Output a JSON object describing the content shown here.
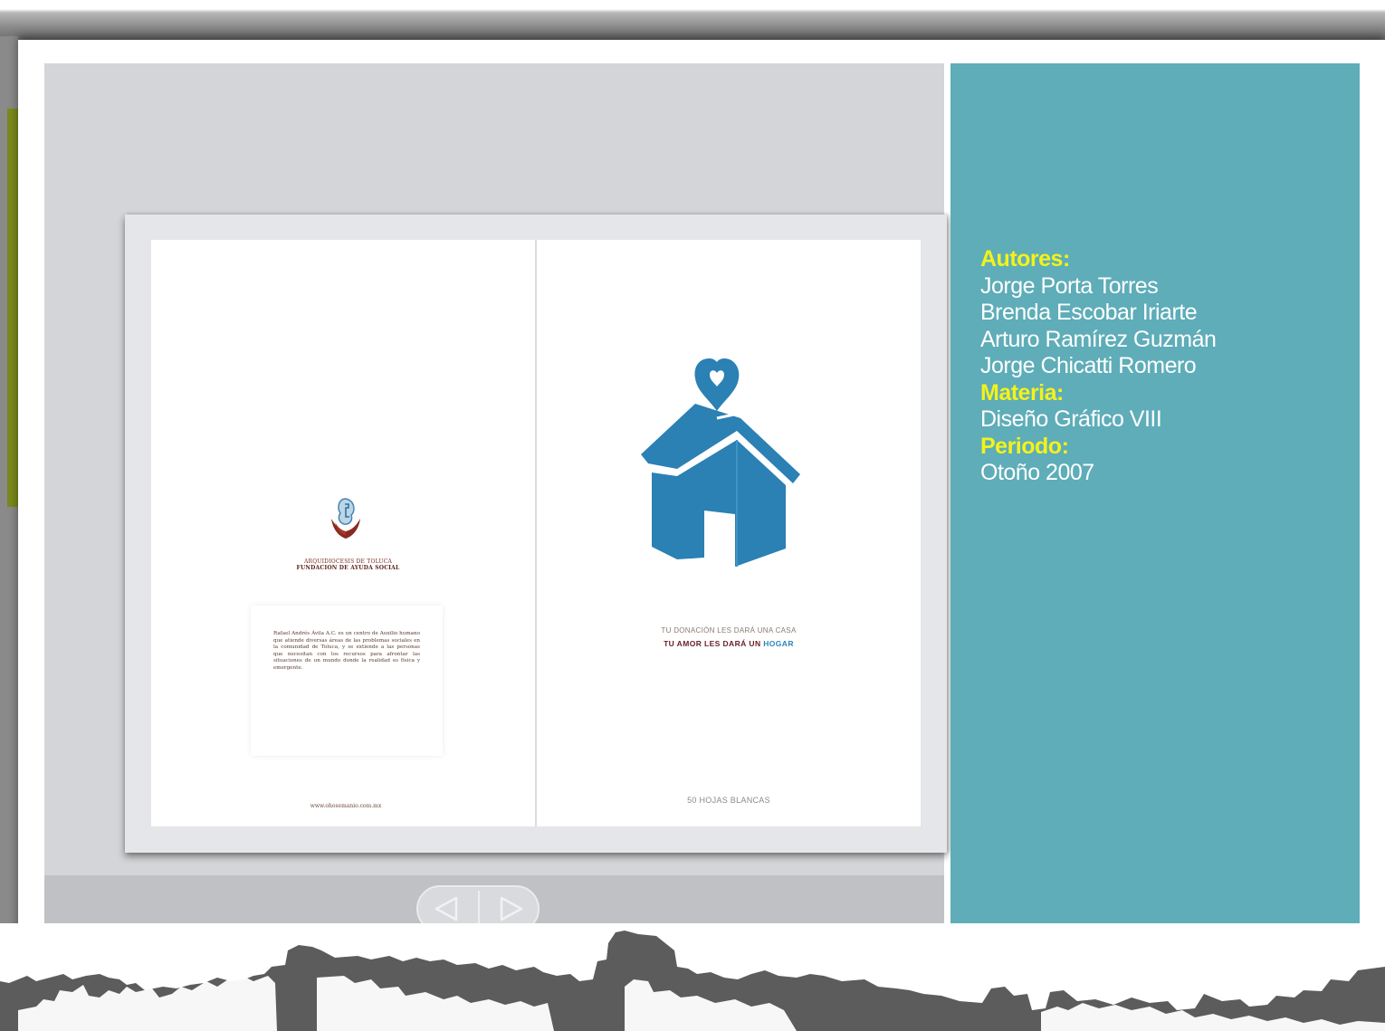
{
  "book": {
    "left_page": {
      "foundation_name_line1": "ARQUIDIOCESIS DE TOLUCA",
      "foundation_name_line2": "FUNDACION DE AYUDA SOCIAL",
      "body_text": "Rafael Andrés Ávila A.C. es un centro de Auxilio humano que atiende diversas áreas de las problemas sociales en la comunidad de Toluca, y se extiende a las personas que necesitan con los recursos para afrontar las situaciones de un mundo donde la realidad es física y emergente.",
      "website": "www.ohosemanio.com.mx"
    },
    "right_page": {
      "slogan_line1": "TU DONACIÓN LES DARÁ UNA CASA",
      "slogan_line2_main": "TU AMOR LES DARÁ UN ",
      "slogan_line2_highlight": "HOGAR",
      "sheets_label": "50 HOJAS BLANCAS"
    }
  },
  "navigation": {
    "prev_icon": "triangle-left-icon",
    "next_icon": "triangle-right-icon"
  },
  "info": {
    "authors_label": "Autores:",
    "authors": [
      "Jorge Porta Torres",
      "Brenda Escobar Iriarte",
      "Arturo Ramírez Guzmán",
      "Jorge Chicatti Romero"
    ],
    "subject_label": "Materia:",
    "subject": "Diseño Gráfico VIII",
    "period_label": "Periodo:",
    "period": "Otoño 2007"
  },
  "colors": {
    "info_panel": "#5eadb8",
    "heading_yellow": "#f4f21a",
    "house_blue": "#2b80b4",
    "viewer_gray": "#d3d5d8"
  }
}
